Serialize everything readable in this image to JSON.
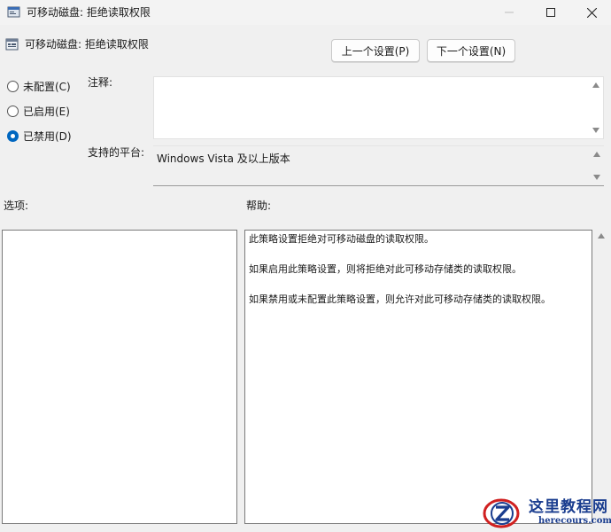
{
  "window": {
    "title": "可移动磁盘: 拒绝读取权限",
    "min_glyph": "—",
    "max_glyph": "☐",
    "close_glyph": "✕"
  },
  "header": {
    "policy_name": "可移动磁盘: 拒绝读取权限",
    "prev_button": "上一个设置(P)",
    "next_button": "下一个设置(N)"
  },
  "state": {
    "options": [
      {
        "label": "未配置(C)",
        "checked": false
      },
      {
        "label": "已启用(E)",
        "checked": false
      },
      {
        "label": "已禁用(D)",
        "checked": true
      }
    ]
  },
  "comment": {
    "label": "注释:",
    "value": ""
  },
  "platform": {
    "label": "支持的平台:",
    "value": "Windows Vista 及以上版本"
  },
  "options_section": {
    "label": "选项:"
  },
  "help_section": {
    "label": "帮助:",
    "paragraphs": [
      "此策略设置拒绝对可移动磁盘的读取权限。",
      "如果启用此策略设置，则将拒绝对此可移动存储类的读取权限。",
      "如果禁用或未配置此策略设置，则允许对此可移动存储类的读取权限。"
    ]
  },
  "watermark": {
    "title": "这里教程网",
    "url": "herecours.com"
  },
  "colors": {
    "accent": "#0067c0",
    "window_bg": "#f0f0f0",
    "watermark_blue": "#1a3d8f",
    "watermark_red": "#d02020"
  }
}
